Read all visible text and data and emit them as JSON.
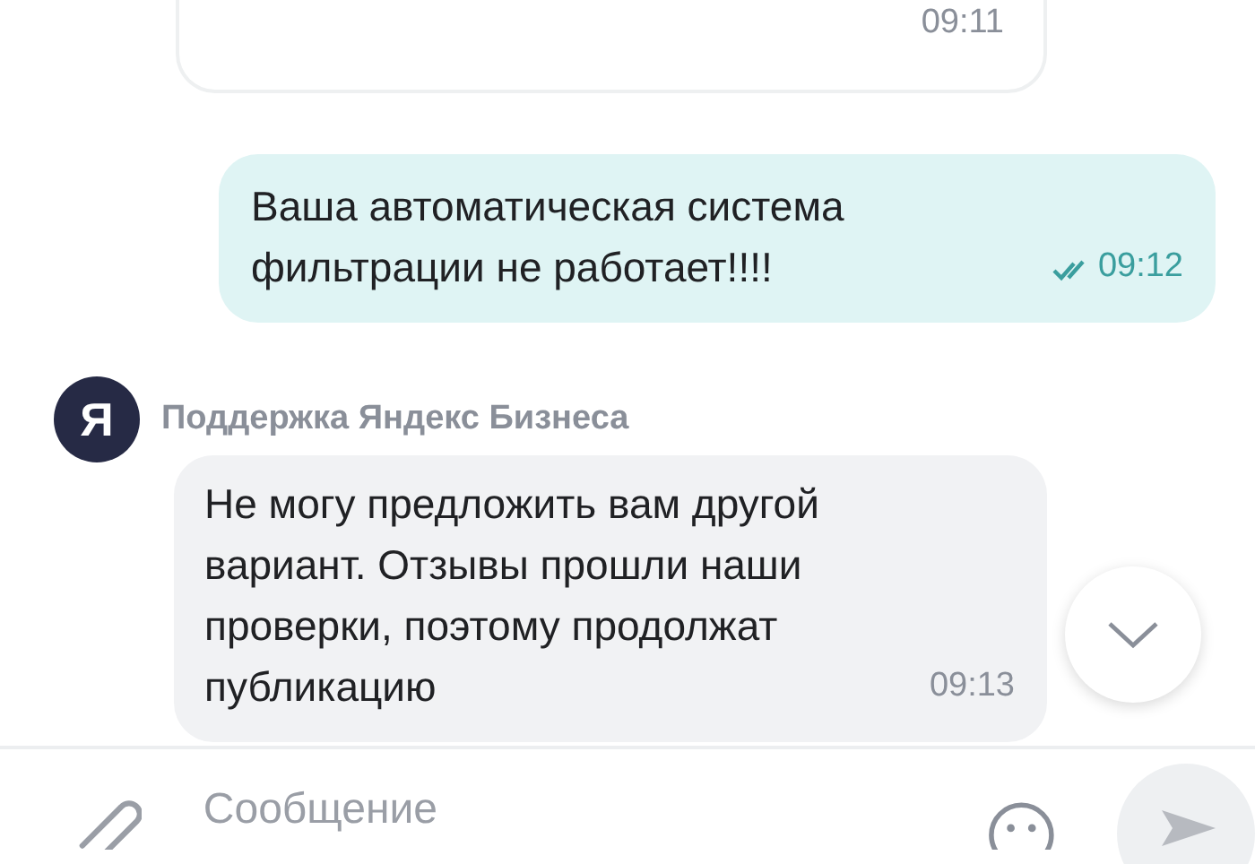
{
  "messages": [
    {
      "kind": "incoming_cut",
      "time": "09:11"
    },
    {
      "kind": "outgoing",
      "lines": [
        "Ваша автоматическая система",
        "фильтрации не работает!!!!"
      ],
      "time": "09:12",
      "read": true
    },
    {
      "kind": "incoming",
      "sender": "Поддержка Яндекс Бизнеса",
      "avatar": "Я",
      "lines": [
        "Не могу предложить вам другой",
        "вариант. Отзывы прошли наши",
        "проверки, поэтому продолжат",
        "публикацию"
      ],
      "time": "09:13"
    }
  ],
  "composer": {
    "placeholder": "Сообщение"
  }
}
